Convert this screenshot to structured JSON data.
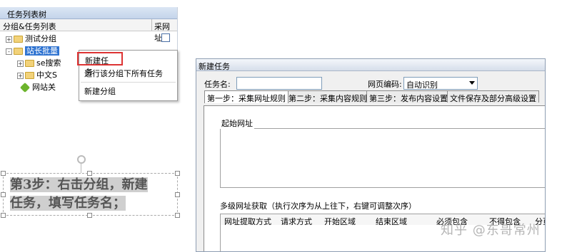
{
  "tree_panel": {
    "title": "任务列表树",
    "header": {
      "col1": "分组&任务列表",
      "col2": "采网址"
    },
    "rows": [
      {
        "expander": "+",
        "label": "测试分组"
      },
      {
        "expander": "-",
        "label": "站长批量"
      },
      {
        "expander": "+",
        "label": "se搜索"
      },
      {
        "expander": "+",
        "label": "中文S"
      },
      {
        "expander": "",
        "label": "网站关"
      }
    ]
  },
  "context_menu": {
    "items": [
      {
        "label": "新建任务",
        "highlighted": true
      },
      {
        "label": "运行该分组下所有任务"
      },
      {
        "label": "新建分组"
      }
    ]
  },
  "annotation": {
    "line1": "第3步：右击分组，新建",
    "line2": "任务，填写任务名；"
  },
  "dialog": {
    "title": "新建任务",
    "task_name_label": "任务名:",
    "task_name_value": "",
    "encoding_label": "网页编码:",
    "encoding_value": "自动识别",
    "tabs": [
      "第一步：采集网址规则",
      "第二步：采集内容规则",
      "第三步：发布内容设置",
      "文件保存及部分高级设置"
    ],
    "start_url_legend": "起始网址",
    "multi_level_legend": "多级网址获取（执行次序为从上往下，右键可调整次序）",
    "table_columns": [
      "网址提取方式",
      "请求方式",
      "开始区域",
      "结束区域",
      "必须包含",
      "不得包含",
      "分页"
    ]
  },
  "watermark": "知乎 @东哥常州"
}
